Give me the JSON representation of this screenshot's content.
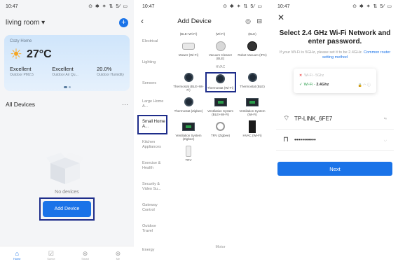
{
  "screen1": {
    "status": {
      "time": "10:47",
      "icons": "⊙ ✱ ✶ ⇅ 5⁄ ▭"
    },
    "room": "living room ▾",
    "weather": {
      "location": "Cozy Home",
      "temperature": "27°C",
      "stats": [
        {
          "value": "Excellent",
          "label": "Outdoor PM2.5"
        },
        {
          "value": "Excellent",
          "label": "Outdoor Air Qu..."
        },
        {
          "value": "20.0%",
          "label": "Outdoor Humidity"
        }
      ]
    },
    "all_devices": "All Devices",
    "more": "···",
    "no_devices": "No devices",
    "add_device": "Add Device",
    "tabs": [
      {
        "icon": "⌂",
        "label": "Home"
      },
      {
        "icon": "☑",
        "label": "Scene"
      },
      {
        "icon": "⊚",
        "label": "Smart"
      },
      {
        "icon": "⊚",
        "label": "Me"
      }
    ]
  },
  "screen2": {
    "status": {
      "time": "10:47",
      "icons": "⊙ ✱ ✶ ⇅ 5⁄ ▭"
    },
    "back": "‹",
    "title": "Add Device",
    "header_icons": "◎ ⊟",
    "categories": [
      "Electrical",
      "Lighting",
      "Sensors",
      "Large Home A...",
      "Small Home A...",
      "Kitchen Appliances",
      "Exercise & Health",
      "Security & Video Su...",
      "Gateway Control",
      "Outdoor Travel",
      "Energy"
    ],
    "selected_category": "Small Home A...",
    "rows": [
      [
        {
          "name": "(BLE+Wi-Fi)",
          "kind": "none"
        },
        {
          "name": "(Wi-Fi)",
          "kind": "none"
        },
        {
          "name": "(BLE)",
          "kind": "none"
        }
      ],
      [
        {
          "name": "Mower (Wi-Fi)",
          "kind": "mower"
        },
        {
          "name": "Vacuum Cleaner (BLE)",
          "kind": "vac"
        },
        {
          "name": "Robot Vacuum (IPC)",
          "kind": "vacdark"
        }
      ]
    ],
    "section_hvac": "HVAC",
    "rows2": [
      [
        {
          "name": "Thermostat (BLE+Wi-Fi)",
          "kind": "thermo"
        },
        {
          "name": "Thermostat (Wi-Fi)",
          "kind": "thermo",
          "highlight": true
        },
        {
          "name": "Thermostat (BLE)",
          "kind": "thermo"
        }
      ],
      [
        {
          "name": "Thermostat (Zigbee)",
          "kind": "thermo"
        },
        {
          "name": "Ventilation System (BLE+Wi-Fi)",
          "kind": "sq"
        },
        {
          "name": "Ventilation System (Wi-Fi)",
          "kind": "sq"
        }
      ],
      [
        {
          "name": "Ventilation System (Zigbee)",
          "kind": "sq"
        },
        {
          "name": "TRV (Zigbee)",
          "kind": "trvd"
        },
        {
          "name": "HVAC (Wi-Fi)",
          "kind": "hvac"
        }
      ],
      [
        {
          "name": "TRV",
          "kind": "trv"
        }
      ]
    ],
    "footer": "Motor"
  },
  "screen3": {
    "status": {
      "time": "10:47",
      "icons": "⊙ ✱ ✶ ⇅ 5⁄ ▭"
    },
    "close": "✕",
    "title": "Select 2.4 GHz Wi-Fi Network and enter password.",
    "subtitle": "If your Wi-Fi is 5GHz, please set it to be 2.4GHz.",
    "link": "Common router setting method",
    "bad_network": "Wi-Fi - 5Ghz",
    "good_network_prefix": "Wi-Fi - ",
    "good_network_band": "2.4Ghz",
    "good_icons": "🔒 ◠ ⓘ",
    "ssid": "TP-LINK_6FE7",
    "ssid_aux": "⇆",
    "password": "•••••••••••",
    "password_aux": "◡",
    "next": "Next"
  }
}
